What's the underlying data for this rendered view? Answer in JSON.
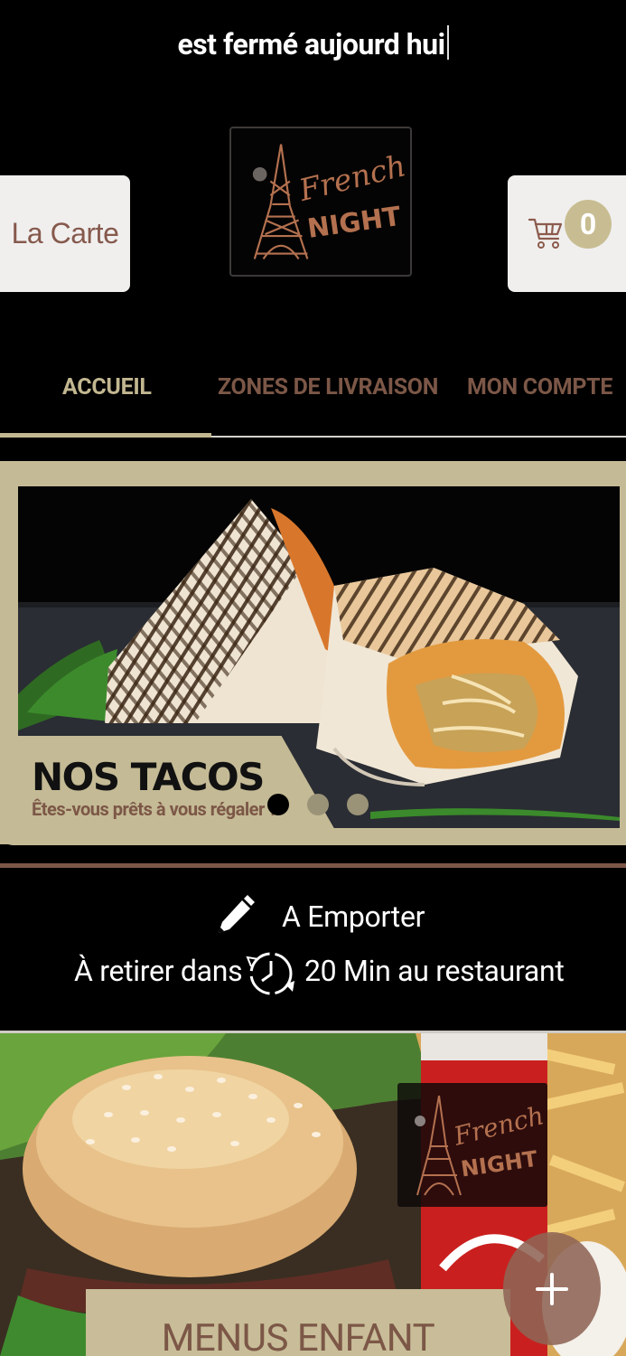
{
  "status": {
    "closed_notice": "est fermé aujourd hui"
  },
  "header": {
    "menu_button": "La Carte",
    "logo": {
      "line1": "French",
      "line2": "NIGHT"
    },
    "cart": {
      "count": "0",
      "icon": "cart-icon"
    }
  },
  "tabs": [
    {
      "label": "ACCUEIL",
      "active": true
    },
    {
      "label": "ZONES DE LIVRAISON",
      "active": false
    },
    {
      "label": "MON COMPTE",
      "active": false
    }
  ],
  "slider": {
    "title": "NOS TACOS",
    "subtitle": "Êtes-vous prêts à vous régaler ?",
    "dots": 3,
    "active_dot": 1
  },
  "order_mode": {
    "mode_label": "A Emporter",
    "time_prefix": "À retirer dans",
    "time_suffix": "20 Min au restaurant",
    "icons": [
      "pencil-icon",
      "clock-icon"
    ]
  },
  "category": {
    "label": "MENUS ENFANT",
    "logo": {
      "line1": "French",
      "line2": "NIGHT"
    }
  },
  "fab": {
    "icon": "plus-icon"
  },
  "colors": {
    "background": "#000000",
    "beige": "#c4ba95",
    "brown": "#7c5747",
    "light": "#f0efee"
  }
}
